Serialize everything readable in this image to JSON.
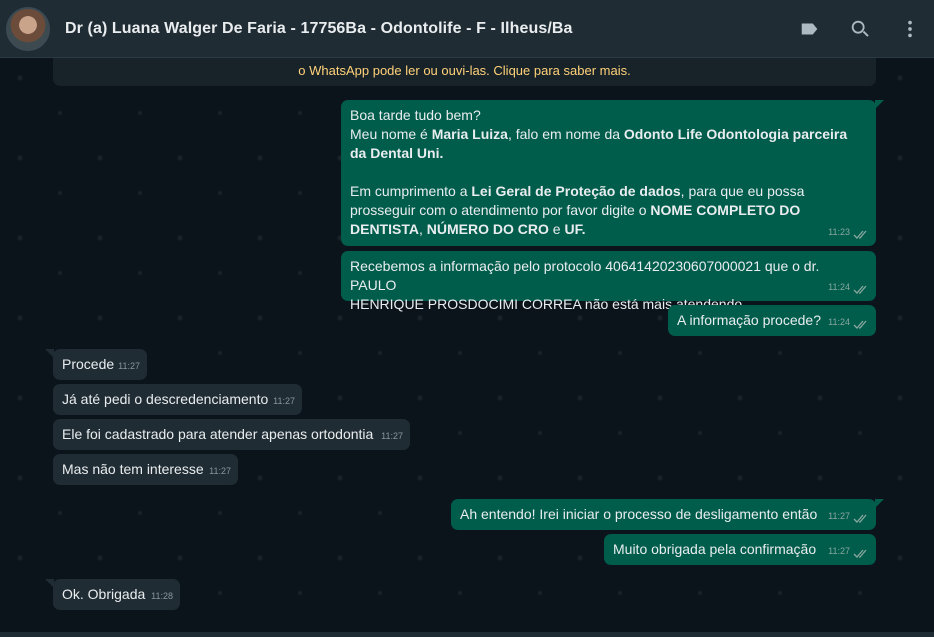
{
  "header": {
    "contact_name": "Dr (a) Luana Walger De Faria - 17756Ba - Odontolife - F - Ilheus/Ba",
    "icons": [
      "label-icon",
      "search-icon",
      "menu-icon"
    ]
  },
  "notice": "o WhatsApp pode ler ou ouvi-las. Clique para saber mais.",
  "messages": {
    "m1": {
      "l1": "Boa tarde  tudo bem?",
      "l2a": "Meu nome é ",
      "l2b": "Maria Luiza",
      "l2c": ", falo em nome da ",
      "l2d": "Odonto Life Odontologia parceira",
      "l3": "da Dental Uni.",
      "l4a": "Em cumprimento a ",
      "l4b": "Lei Geral de Proteção de dados",
      "l4c": ", para que eu possa",
      "l5a": "prosseguir com o atendimento por favor digite o ",
      "l5b": "NOME COMPLETO DO",
      "l6a": "DENTISTA",
      "l6b": ", ",
      "l6c": "NÚMERO DO CRO",
      "l6d": " e ",
      "l6e": "UF.",
      "time": "11:23"
    },
    "m2": {
      "l1": "Recebemos a informação pelo protocolo 40641420230607000021 que o dr. PAULO",
      "l2": "HENRIQUE PROSDOCIMI CORREA não está mais atendendo",
      "time": "11:24"
    },
    "m3": {
      "text": "A informação procede?",
      "time": "11:24"
    },
    "m4": {
      "text": "Procede",
      "time": "11:27"
    },
    "m5": {
      "text": "Já até pedi o descredenciamento",
      "time": "11:27"
    },
    "m6": {
      "text": "Ele foi cadastrado para atender apenas ortodontia",
      "time": "11:27"
    },
    "m7": {
      "text": "Mas não tem interesse",
      "time": "11:27"
    },
    "m8": {
      "text": "Ah entendo! Irei iniciar o processo de desligamento então",
      "time": "11:27"
    },
    "m9": {
      "text": "Muito obrigada pela confirmação",
      "time": "11:27"
    },
    "m10": {
      "text": "Ok. Obrigada",
      "time": "11:28"
    }
  },
  "colors": {
    "outgoing_bubble": "#005c4b",
    "incoming_bubble": "#202c33",
    "header": "#202c33",
    "background": "#0b141a",
    "read_ticks": "#8aa8a0"
  }
}
